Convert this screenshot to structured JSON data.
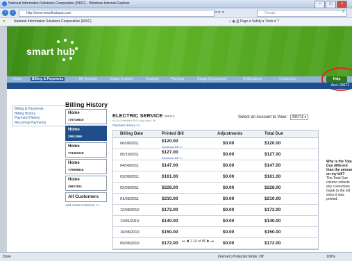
{
  "window": {
    "title": "National Information Solutions Cooperative (NISC) - Windows Internet Explorer",
    "url": "http://www.smarthubapp.com",
    "search_placeholder": "Google",
    "tab_title": "National Information Solutions Cooperative (NISC)",
    "command_items": [
      "Page",
      "Safety",
      "Tools"
    ]
  },
  "header": {
    "logo_text": "smart hub",
    "help_label": "Help",
    "account_label": "Acct: 29671"
  },
  "nav": {
    "items": [
      "Home",
      "Billing & Payments",
      "My Account",
      "Usage Explorer",
      "Analysis",
      "Planning",
      "Usage Comparison",
      "Notifications",
      "Contact Us"
    ]
  },
  "left_links": [
    "Billing & Payments",
    "Billing History",
    "Payment History",
    "Recurring Payments"
  ],
  "page_title": "Billing History",
  "accounts": [
    {
      "name": "Home",
      "number": "776749916"
    },
    {
      "name": "Home",
      "number": "29913969"
    },
    {
      "name": "Home",
      "number": "774461218"
    },
    {
      "name": "Home",
      "number": "779896816"
    },
    {
      "name": "Home",
      "number": "29927821"
    }
  ],
  "all_customers": "All Customers",
  "add_account": "Add a New Customer >>",
  "service": {
    "title": "ELECTRIC SERVICE",
    "code": "295712",
    "address": "4424 Greenfield Rd, Long Lake, MI",
    "payment_history_link": "Payment History >>",
    "select_label": "Select an Account to View:",
    "selected_account": "295712"
  },
  "table": {
    "headers": [
      "Billing Date",
      "Printed Bill",
      "Adjustments",
      "Total Due"
    ],
    "download_label": "Download Bill >>",
    "rows": [
      {
        "date": "06/08/2011",
        "bill": "$120.00",
        "download": true,
        "adj": "$0.00",
        "due": "$120.00"
      },
      {
        "date": "05/10/2011",
        "bill": "$127.00",
        "download": true,
        "adj": "$0.00",
        "due": "$127.00"
      },
      {
        "date": "04/08/2011",
        "bill": "$147.00",
        "download": false,
        "adj": "$0.00",
        "due": "$147.00"
      },
      {
        "date": "03/08/2011",
        "bill": "$161.00",
        "download": false,
        "adj": "$0.00",
        "due": "$161.00"
      },
      {
        "date": "02/08/2011",
        "bill": "$228.00",
        "download": false,
        "adj": "$0.00",
        "due": "$228.00"
      },
      {
        "date": "01/08/2011",
        "bill": "$210.00",
        "download": false,
        "adj": "$0.00",
        "due": "$210.00"
      },
      {
        "date": "12/08/2010",
        "bill": "$172.00",
        "download": false,
        "adj": "$0.00",
        "due": "$172.00"
      },
      {
        "date": "11/09/2010",
        "bill": "$140.00",
        "download": false,
        "adj": "$0.00",
        "due": "$140.00"
      },
      {
        "date": "10/08/2010",
        "bill": "$150.00",
        "download": false,
        "adj": "$0.00",
        "due": "$150.00"
      },
      {
        "date": "09/08/2010",
        "bill": "$172.00",
        "download": false,
        "adj": "$0.00",
        "due": "$172.00"
      }
    ]
  },
  "pager": "1-10 of 86",
  "sidenote": {
    "question": "Why is the Total Due different than the amount on my bill?",
    "answer": "The Total Due column reflects any corrections made to the bill since it was printed."
  },
  "status": {
    "left": "Done",
    "center": "Internet | Protected Mode: Off",
    "zoom": "100%"
  },
  "colors": {
    "brand_green": "#4b9c1c",
    "nav_blue": "#1f4e8a",
    "help_circle": "#e0262b"
  }
}
